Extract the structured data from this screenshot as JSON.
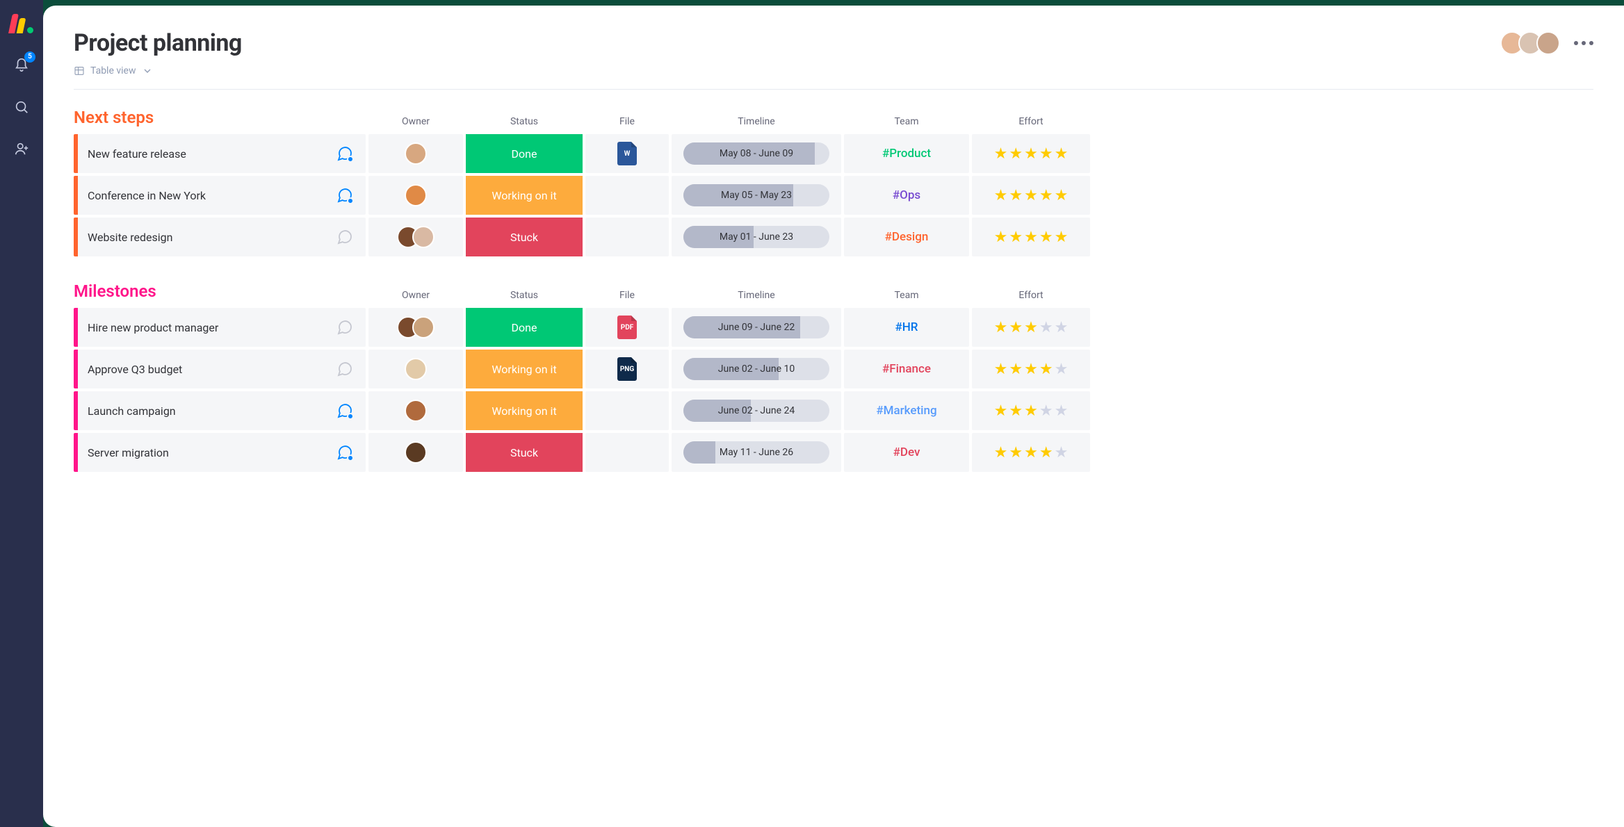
{
  "page": {
    "title": "Project planning"
  },
  "view": {
    "label": "Table view"
  },
  "sidebar": {
    "notification_count": "5"
  },
  "columns": {
    "owner": "Owner",
    "status": "Status",
    "file": "File",
    "timeline": "Timeline",
    "team": "Team",
    "effort": "Effort"
  },
  "header_avatars": [
    {
      "bg": "#e7b897"
    },
    {
      "bg": "#d9c3b2"
    },
    {
      "bg": "#c9a48a"
    }
  ],
  "status_colors": {
    "Done": "#00c875",
    "Working on it": "#fdab3d",
    "Stuck": "#e2445c"
  },
  "team_colors": {
    "Product": "#00c875",
    "Ops": "#784bd1",
    "Design": "#ff642e",
    "HR": "#0073ea",
    "Finance": "#e2445c",
    "Marketing": "#579bfc",
    "Dev": "#e2445c"
  },
  "groups": [
    {
      "id": "next-steps",
      "title": "Next steps",
      "color": "#ff642e",
      "rows": [
        {
          "name": "New feature release",
          "chat": "active",
          "owners": [
            {
              "bg": "#d7a780"
            }
          ],
          "status": "Done",
          "file": {
            "label": "W",
            "bg": "#2b579a"
          },
          "timeline": "May 08 - June 09",
          "fill": 90,
          "team": "Product",
          "stars": 5
        },
        {
          "name": "Conference in New York",
          "chat": "active",
          "owners": [
            {
              "bg": "#e08a46"
            }
          ],
          "status": "Working on it",
          "file": null,
          "timeline": "May 05 - May 23",
          "fill": 75,
          "team": "Ops",
          "stars": 5
        },
        {
          "name": "Website redesign",
          "chat": "inactive",
          "owners": [
            {
              "bg": "#7a4a2d"
            },
            {
              "bg": "#d9b9a3"
            }
          ],
          "status": "Stuck",
          "file": null,
          "timeline": "May 01 - June 23",
          "fill": 48,
          "team": "Design",
          "stars": 5
        }
      ]
    },
    {
      "id": "milestones",
      "title": "Milestones",
      "color": "#ff158a",
      "rows": [
        {
          "name": "Hire new product manager",
          "chat": "inactive",
          "owners": [
            {
              "bg": "#7a4a2d"
            },
            {
              "bg": "#caa27b"
            }
          ],
          "status": "Done",
          "file": {
            "label": "PDF",
            "bg": "#e2445c"
          },
          "timeline": "June 09 - June 22",
          "fill": 80,
          "team": "HR",
          "stars": 3
        },
        {
          "name": "Approve Q3 budget",
          "chat": "inactive",
          "owners": [
            {
              "bg": "#e2caa8"
            }
          ],
          "status": "Working on it",
          "file": {
            "label": "PNG",
            "bg": "#0f2a4a"
          },
          "timeline": "June 02 - June 10",
          "fill": 65,
          "team": "Finance",
          "stars": 4
        },
        {
          "name": "Launch campaign",
          "chat": "active",
          "owners": [
            {
              "bg": "#b06a3d"
            }
          ],
          "status": "Working on it",
          "file": null,
          "timeline": "June 02  - June 24",
          "fill": 46,
          "team": "Marketing",
          "stars": 3
        },
        {
          "name": "Server migration",
          "chat": "active",
          "owners": [
            {
              "bg": "#5a3a22"
            }
          ],
          "status": "Stuck",
          "file": null,
          "timeline": "May 11 - June 26",
          "fill": 22,
          "team": "Dev",
          "stars": 4
        }
      ]
    }
  ]
}
